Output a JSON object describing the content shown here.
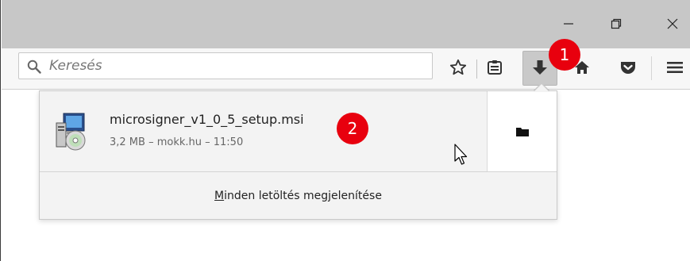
{
  "window": {
    "minimize_icon": "minimize-icon",
    "maximize_icon": "restore-icon",
    "close_icon": "close-icon"
  },
  "toolbar": {
    "search": {
      "placeholder": "Keresés",
      "value": ""
    },
    "icons": [
      "star-icon",
      "reader-list-icon",
      "download-icon",
      "home-icon",
      "pocket-icon",
      "menu-icon"
    ]
  },
  "annotations": {
    "badge1": "1",
    "badge2": "2",
    "badge_color": "#e8000e"
  },
  "downloads_panel": {
    "items": [
      {
        "filename": "microsigner_v1_0_5_setup.msi",
        "meta": "3,2 MB – mokk.hu – 11:50",
        "icon": "msi-installer-icon",
        "action_icon": "folder-icon"
      }
    ],
    "show_all_accesskey": "M",
    "show_all_rest": "inden letöltés megjelenítése"
  }
}
